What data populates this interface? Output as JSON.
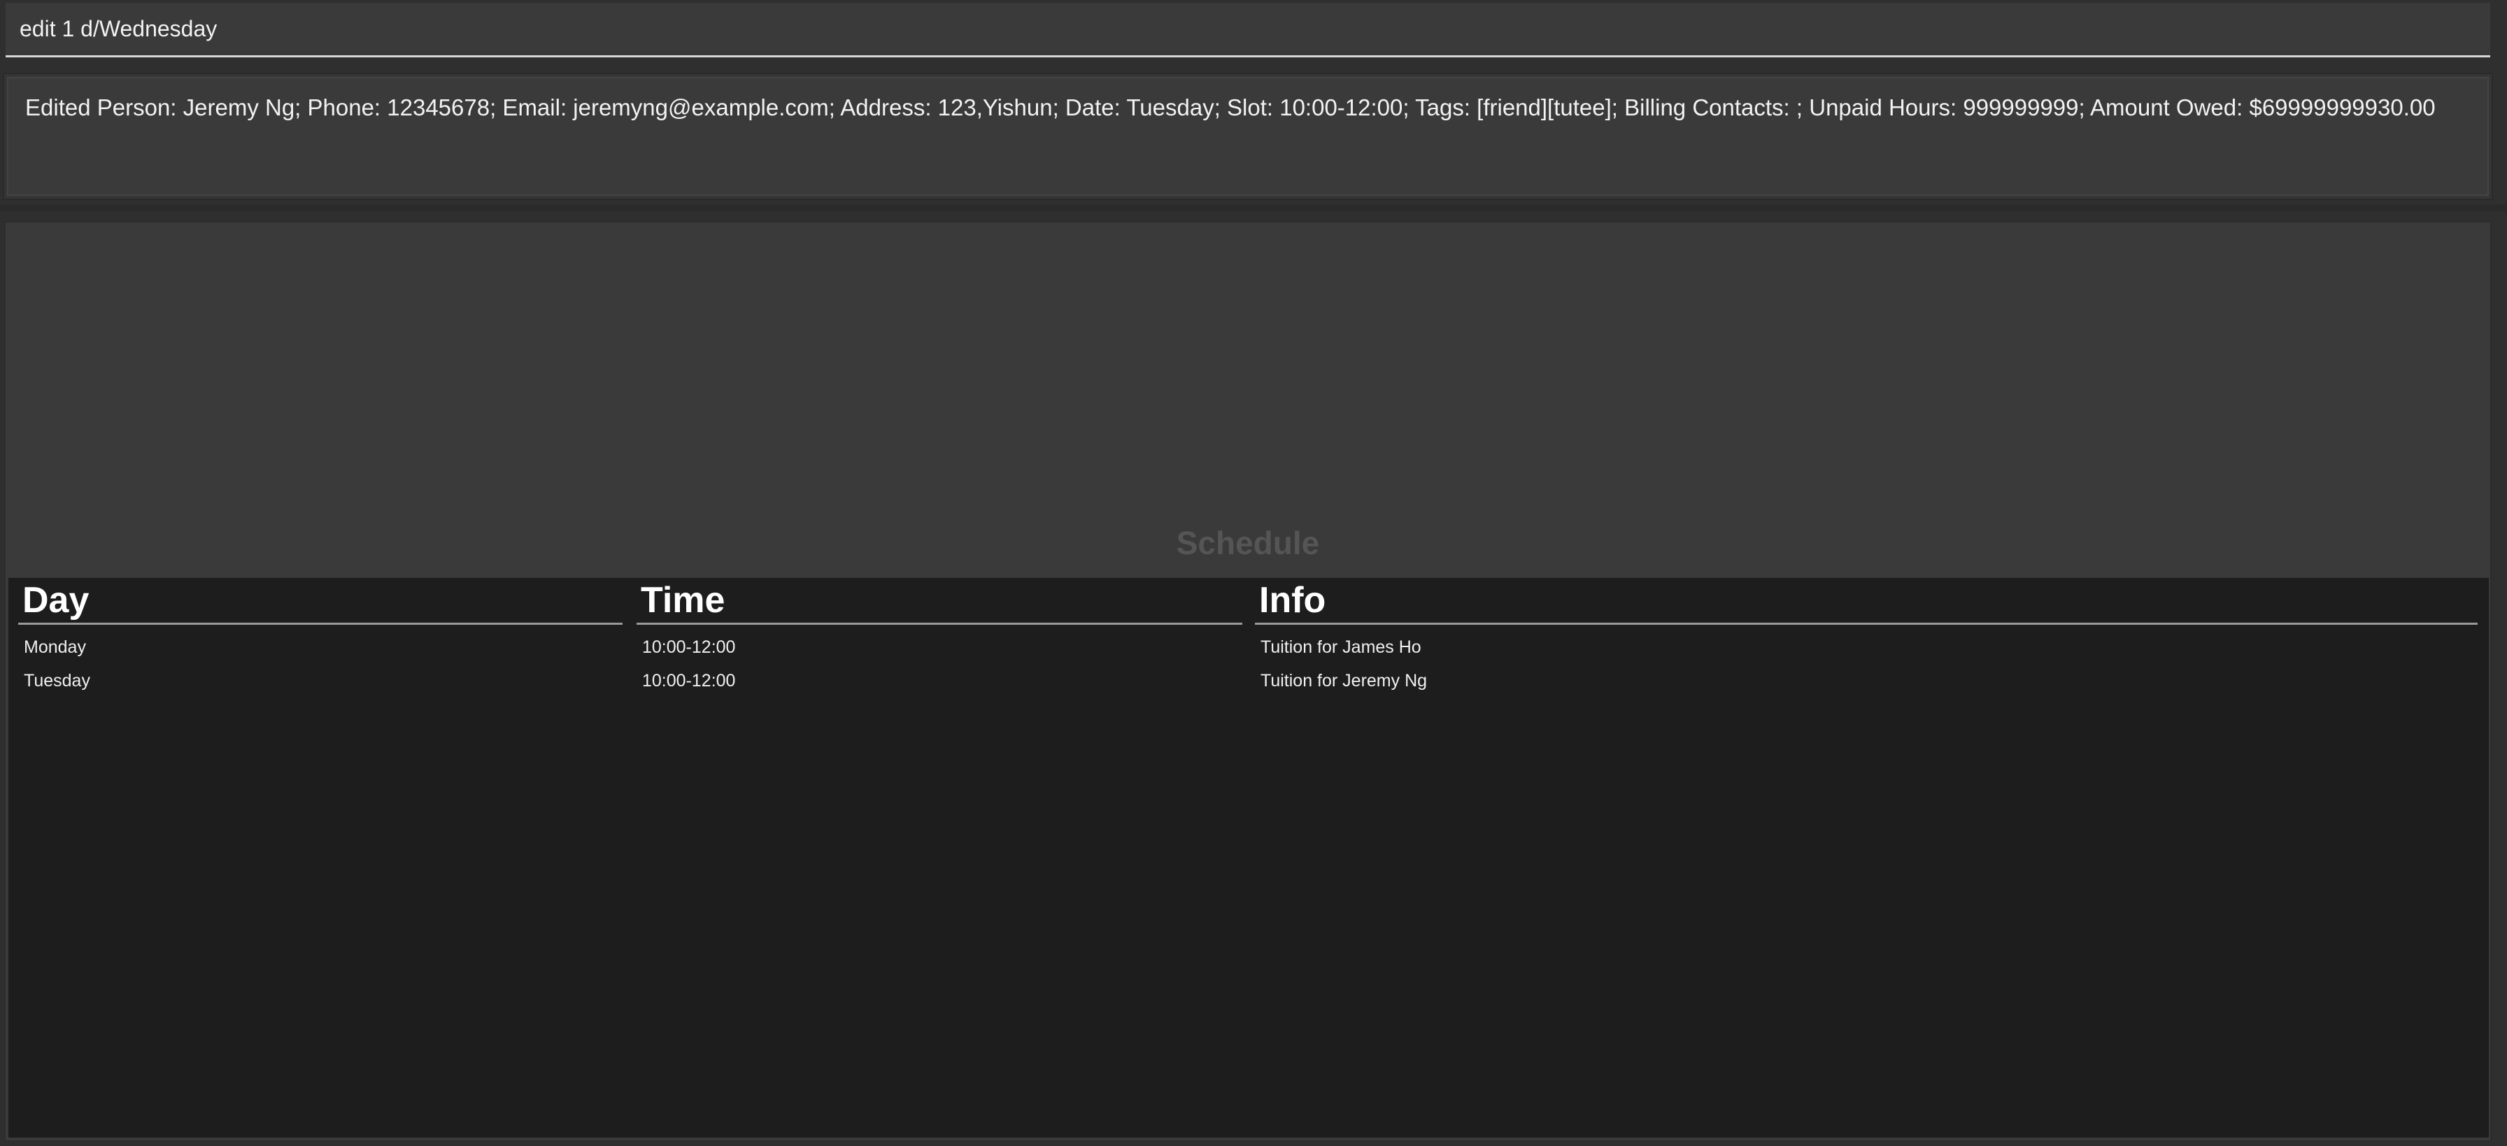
{
  "command": {
    "value": "edit 1 d/Wednesday"
  },
  "result": {
    "message": "Edited Person: Jeremy Ng; Phone: 12345678; Email: jeremyng@example.com; Address: 123,Yishun; Date: Tuesday; Slot: 10:00-12:00; Tags: [friend][tutee]; Billing Contacts: ; Unpaid Hours: 999999999; Amount Owed: $69999999930.00"
  },
  "schedule": {
    "title": "Schedule",
    "columns": [
      "Day",
      "Time",
      "Info"
    ],
    "rows": [
      {
        "day": "Monday",
        "time": "10:00-12:00",
        "info": "Tuition for James Ho"
      },
      {
        "day": "Tuesday",
        "time": "10:00-12:00",
        "info": "Tuition for Jeremy Ng"
      }
    ]
  }
}
